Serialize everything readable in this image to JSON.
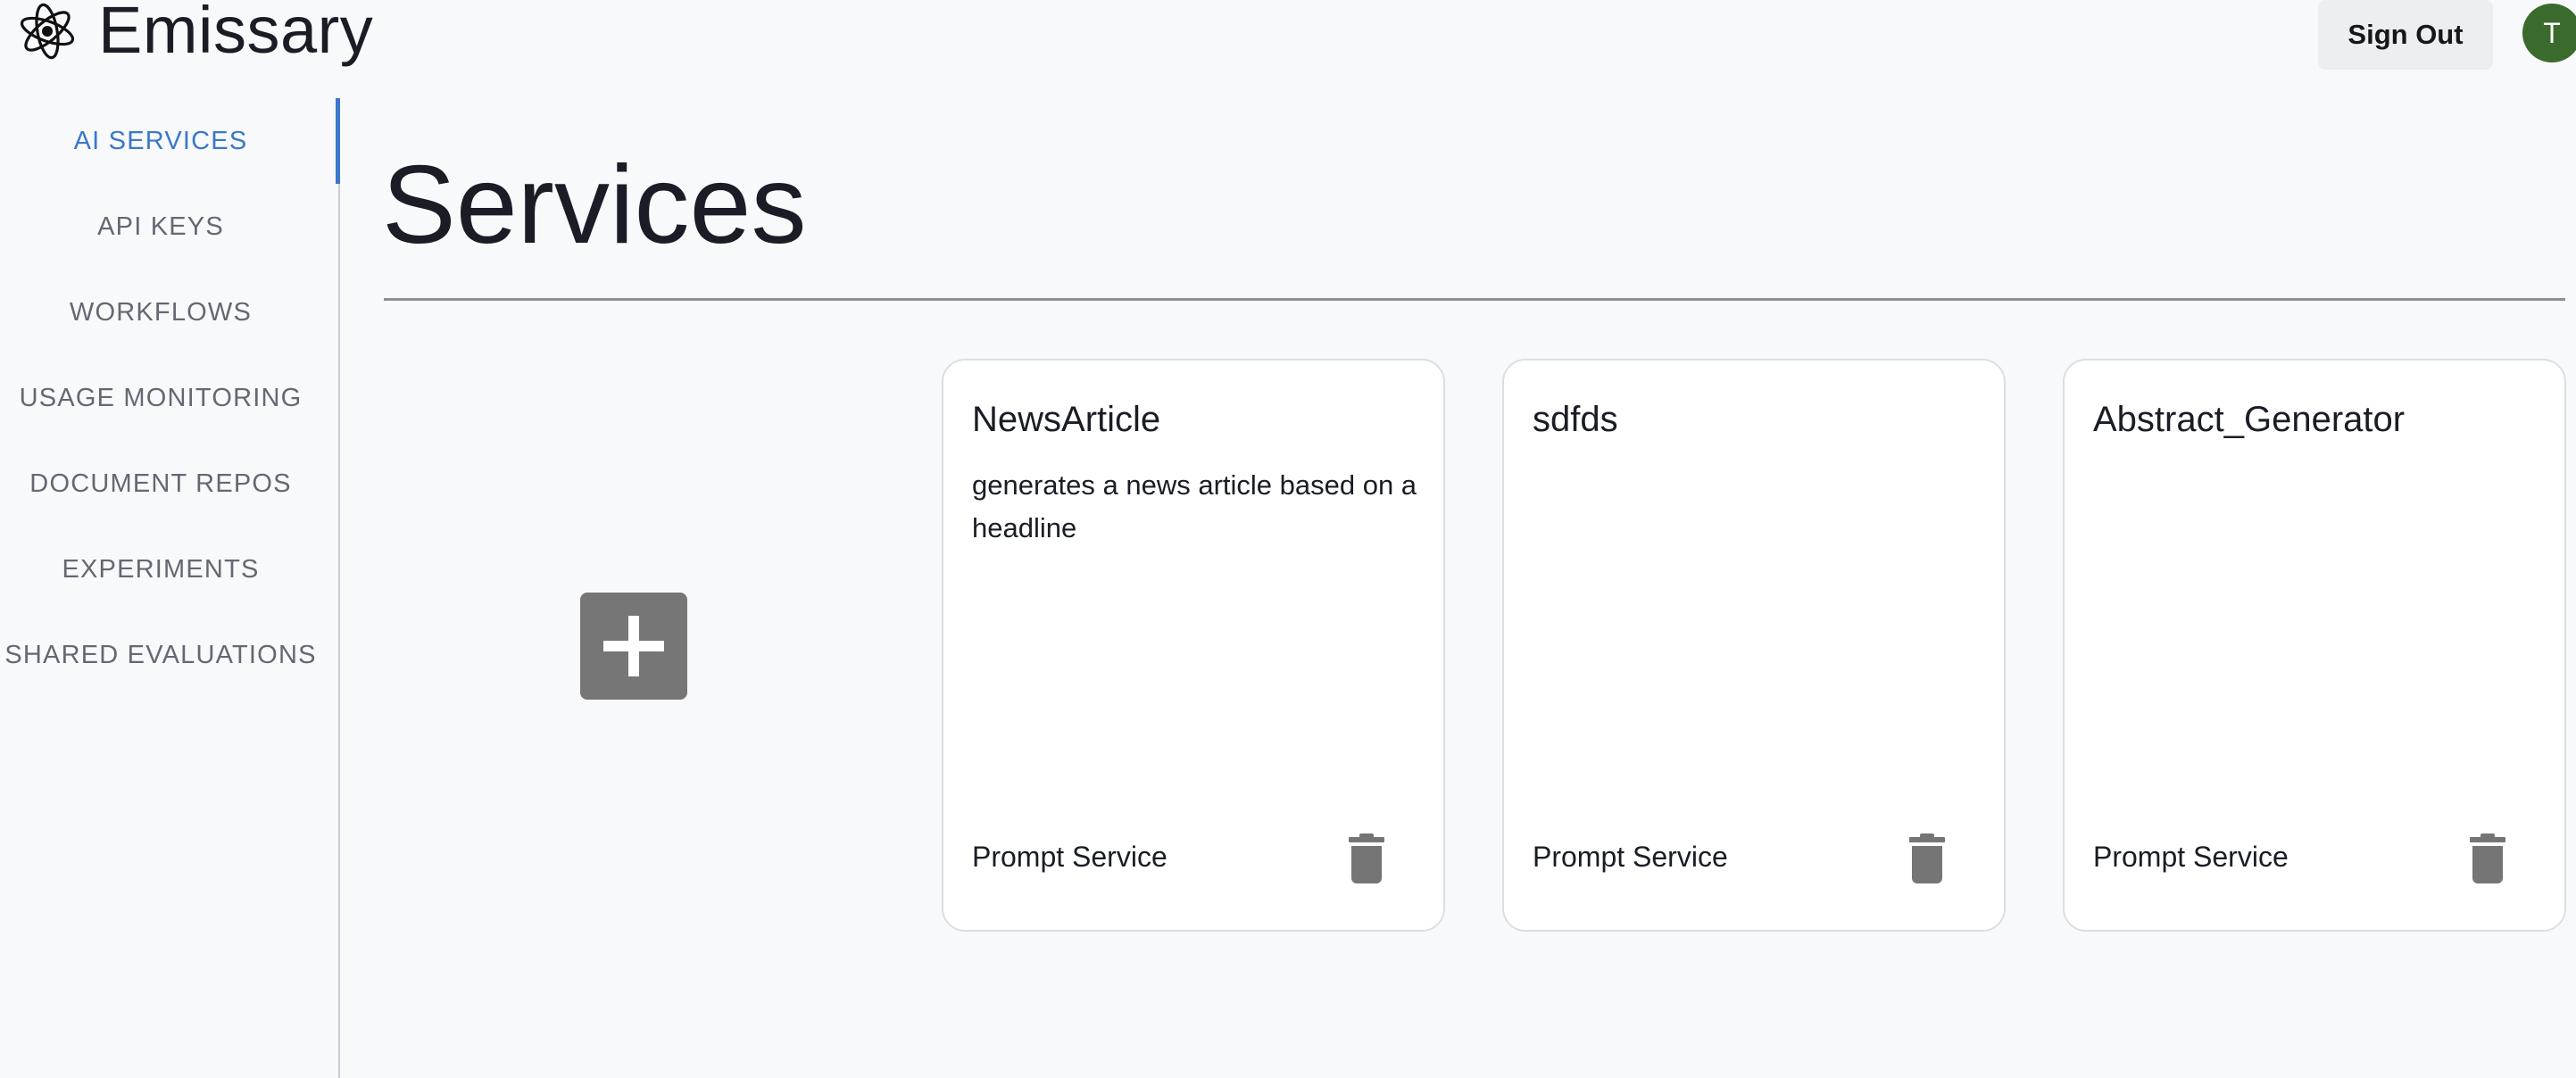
{
  "header": {
    "app_title": "Emissary",
    "logo_icon": "emissary-logo-icon",
    "sign_out_label": "Sign Out",
    "avatar_initial": "T",
    "avatar_color": "#3a6b2d"
  },
  "sidebar": {
    "accent_color": "#3a78c9",
    "items": [
      {
        "label": "AI SERVICES",
        "active": true
      },
      {
        "label": "API KEYS",
        "active": false
      },
      {
        "label": "WORKFLOWS",
        "active": false
      },
      {
        "label": "USAGE MONITORING",
        "active": false
      },
      {
        "label": "DOCUMENT REPOS",
        "active": false
      },
      {
        "label": "EXPERIMENTS",
        "active": false
      },
      {
        "label": "SHARED EVALUATIONS",
        "active": false
      }
    ]
  },
  "main": {
    "title": "Services",
    "add_button_icon": "plus-icon",
    "cards": [
      {
        "title": "NewsArticle",
        "description": "generates a news article based on a headline",
        "type": "Prompt Service",
        "action_icon": "trash-icon"
      },
      {
        "title": "sdfds",
        "description": "",
        "type": "Prompt Service",
        "action_icon": "trash-icon"
      },
      {
        "title": "Abstract_Generator",
        "description": "",
        "type": "Prompt Service",
        "action_icon": "trash-icon"
      }
    ]
  }
}
